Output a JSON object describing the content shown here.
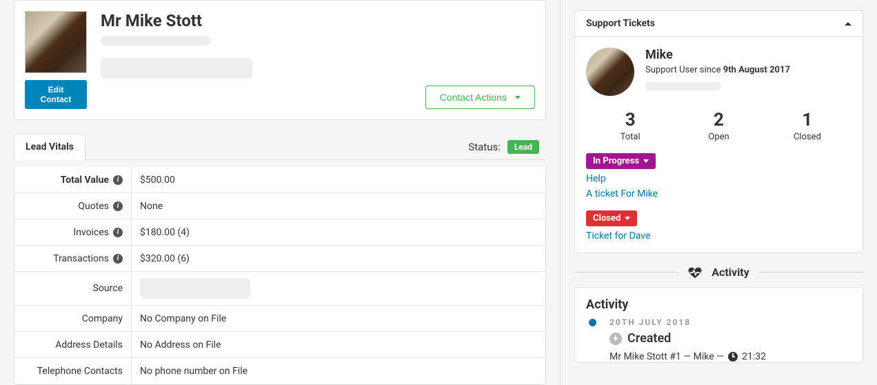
{
  "contact": {
    "name": "Mr Mike Stott",
    "edit_button": "Edit Contact",
    "actions_button": "Contact Actions"
  },
  "tabs": {
    "lead_vitals": "Lead Vitals",
    "status_label": "Status:",
    "status_badge": "Lead"
  },
  "vitals": {
    "total_value": {
      "label": "Total Value",
      "value": "$500.00"
    },
    "quotes": {
      "label": "Quotes",
      "value": "None"
    },
    "invoices": {
      "label": "Invoices",
      "value": "$180.00 (4)"
    },
    "transactions": {
      "label": "Transactions",
      "value": "$320.00 (6)"
    },
    "source": {
      "label": "Source"
    },
    "company": {
      "label": "Company",
      "value": "No Company on File"
    },
    "address": {
      "label": "Address Details",
      "value": "No Address on File"
    },
    "telephone": {
      "label": "Telephone Contacts",
      "value": "No phone number on File"
    }
  },
  "support": {
    "header": "Support Tickets",
    "user_name": "Mike",
    "since_prefix": "Support User since ",
    "since_date": "9th August 2017",
    "stats": {
      "total": {
        "num": "3",
        "label": "Total"
      },
      "open": {
        "num": "2",
        "label": "Open"
      },
      "closed": {
        "num": "1",
        "label": "Closed"
      }
    },
    "in_progress_badge": "In Progress",
    "in_progress_tickets": [
      "Help",
      "A ticket For Mike"
    ],
    "closed_badge": "Closed",
    "closed_tickets": [
      "Ticket for Dave"
    ]
  },
  "activity_divider": "Activity",
  "activity": {
    "title": "Activity",
    "date": "20TH JULY 2018",
    "created_label": "Created",
    "line_prefix": "Mr Mike Stott #1 — Mike — ",
    "line_time": "21:32"
  }
}
